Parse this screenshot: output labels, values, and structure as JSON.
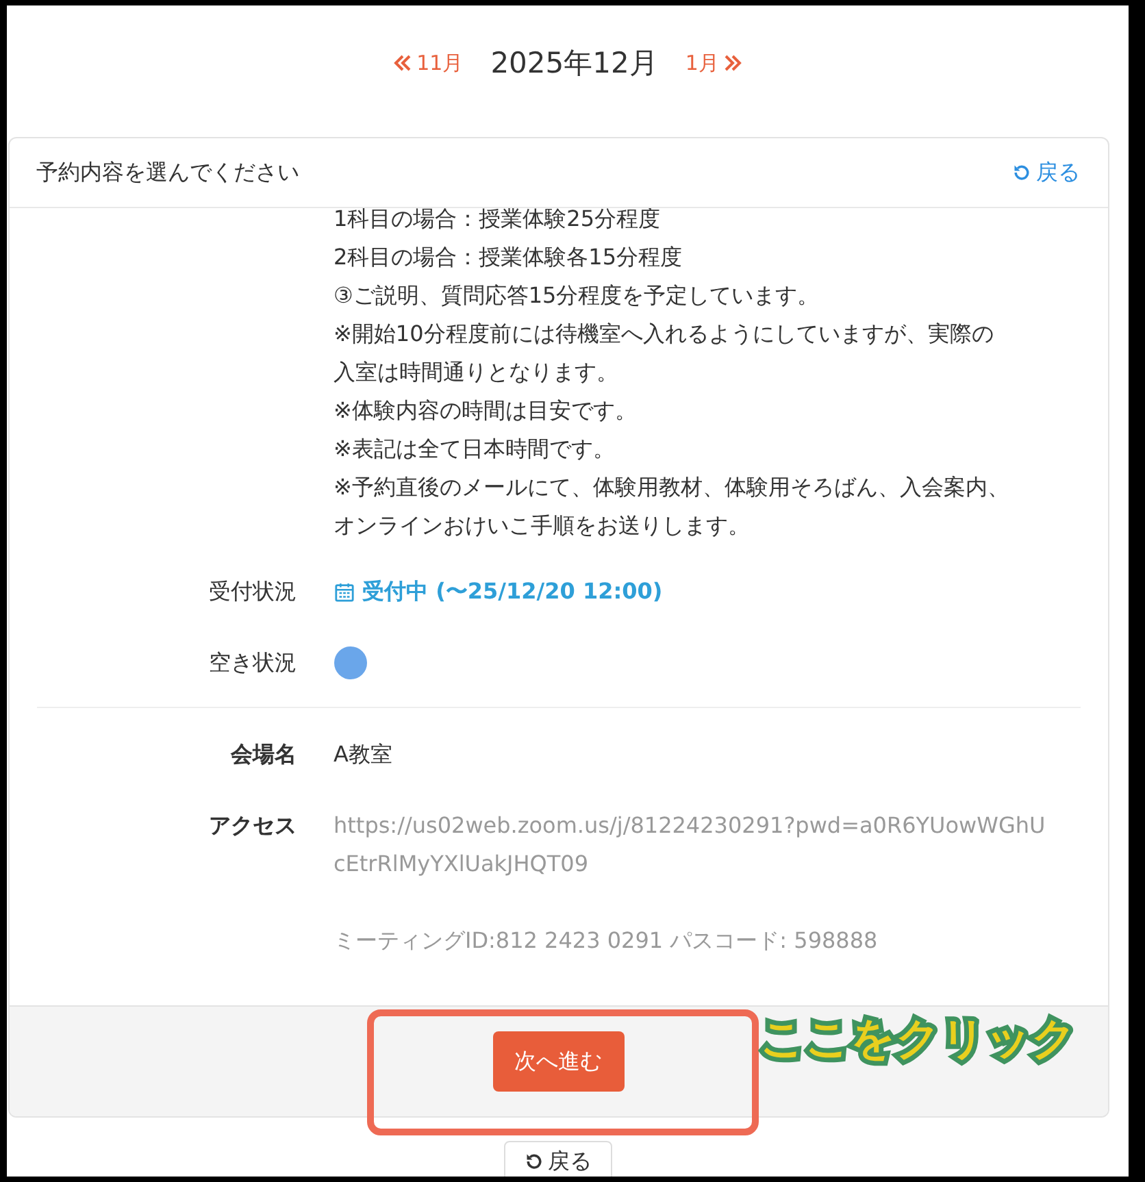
{
  "month_nav": {
    "prev": "11月",
    "current": "2025年12月",
    "next": "1月"
  },
  "card": {
    "title": "予約内容を選んでください",
    "back": "戻る",
    "description_lines": [
      "1科目の場合：授業体験25分程度",
      "2科目の場合：授業体験各15分程度",
      "③ご説明、質問応答15分程度を予定しています。",
      "※開始10分程度前には待機室へ入れるようにしていますが、実際の",
      "入室は時間通りとなります。",
      "※体験内容の時間は目安です。",
      "※表記は全て日本時間です。",
      "※予約直後のメールにて、体験用教材、体験用そろばん、入会案内、",
      "オンラインおけいこ手順をお送りします。"
    ],
    "sections": [
      {
        "bold_labels": false,
        "rows": [
          {
            "kind": "status",
            "label": "受付状況",
            "value": "受付中 (〜25/12/20 12:00)"
          },
          {
            "kind": "dot",
            "label": "空き状況",
            "color": "#6aa6ea"
          }
        ]
      },
      {
        "bold_labels": true,
        "rows": [
          {
            "kind": "text",
            "label": "会場名",
            "paragraphs": [
              "A教室"
            ]
          },
          {
            "kind": "faded",
            "label": "アクセス",
            "paragraphs": [
              "https://us02web.zoom.us/j/81224230291?pwd=a0R6YUowWGhUcEtrRlMyYXlUakJHQT09",
              "ミーティングID:812 2423 0291 パスコード: 598888"
            ]
          }
        ]
      }
    ],
    "next_button": "次へ進む"
  },
  "annotation": "ここをクリック",
  "bottom_button": "戻る"
}
